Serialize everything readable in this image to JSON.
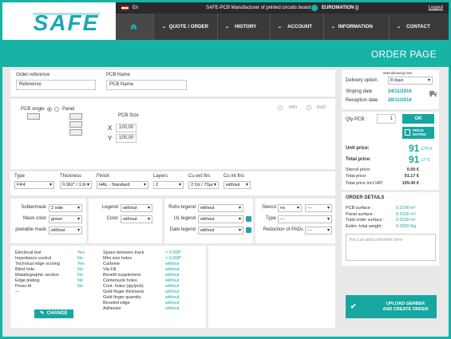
{
  "brand": {
    "logo_text": "SAFE"
  },
  "topbar": {
    "lang": "En",
    "title": "SAFE-PCB Manufacturer of printed circuits board",
    "user": "EUROMATION ()",
    "logout": "Logout"
  },
  "nav": {
    "items": [
      "QUOTE / ORDER",
      "HISTORY",
      "ACCOUNT",
      "INFORMATION",
      "CONTACT"
    ]
  },
  "page": {
    "title": "ORDER PAGE"
  },
  "reference": {
    "order_label": "Order reference",
    "order_placeholder": "Reference",
    "pcb_label": "PCB Name",
    "pcb_placeholder": "PCB Name"
  },
  "pcb": {
    "single_label": "PCB single",
    "panel_label": "Panel",
    "size_label": "PCB Size",
    "x_label": "X",
    "y_label": "Y",
    "x_value": "100,00",
    "y_value": "100,00",
    "unit_mm": "mm",
    "unit_inch": "inch"
  },
  "specs": {
    "type_label": "Type",
    "type_value": "FR4",
    "thickness_label": "Thickness",
    "thickness_value": "0.062\" / 1.6r",
    "finish_label": "Finish",
    "finish_value": "HAL - Standard",
    "layers_label": "Layers",
    "layers_value": "2",
    "cu_ext_label": "Cu ext fini.",
    "cu_ext_value": "2 Oz / 70µr",
    "cu_int_label": "Cu int fini.",
    "cu_int_value": "without"
  },
  "masks": {
    "soldermask_label": "Soldermask",
    "soldermask_value": "2 side",
    "maskcolor_label": "Mask color",
    "maskcolor_value": "green",
    "peelable_label": "peelable mask",
    "peelable_value": "without"
  },
  "legend": {
    "legend_label": "Legend",
    "legend_value": "without",
    "color_label": "Color",
    "color_value": "without"
  },
  "legends2": {
    "rohs_label": "Rohs legend",
    "rohs_value": "without",
    "ul_label": "UL legend",
    "ul_value": "without",
    "date_label": "Date legend",
    "date_value": "without"
  },
  "stencil": {
    "stencil_label": "Stencil",
    "stencil_value": "no",
    "stencil_value2": "---",
    "type_label": "Type",
    "type_value": "---",
    "reduction_label": "Reduction of PADs",
    "reduction_value": "---"
  },
  "options": {
    "left": [
      {
        "label": "Electrical test",
        "value": "Yes"
      },
      {
        "label": "Impedance control",
        "value": "No"
      },
      {
        "label": "Technical edge scoring",
        "value": "Yes"
      },
      {
        "label": "Blind hole",
        "value": "No"
      },
      {
        "label": "Matallographic section",
        "value": "No"
      },
      {
        "label": "Edge plating",
        "value": "No"
      },
      {
        "label": "Press-fit",
        "value": "No"
      },
      {
        "label": "---",
        "value": ""
      }
    ],
    "right": [
      {
        "label": "Space between track",
        "value": "> 0.008\""
      },
      {
        "label": "Mini size holes",
        "value": "> 0.008\""
      },
      {
        "label": "Carbone",
        "value": "without"
      },
      {
        "label": "Via Fill",
        "value": "without"
      },
      {
        "label": "Benefit supplement",
        "value": "without"
      },
      {
        "label": "Contersunk holes",
        "value": "without"
      },
      {
        "label": "Cont. holes (qty/pcb)",
        "value": "without"
      },
      {
        "label": "Gold finger thickness",
        "value": "without"
      },
      {
        "label": "Gold finger quantity",
        "value": "without"
      },
      {
        "label": "Beveled edge",
        "value": "without"
      },
      {
        "label": "Adhesive",
        "value": "without"
      }
    ],
    "change_button": "CHANGE"
  },
  "delivery": {
    "option_label": "Delivery option",
    "mfg_time_label": "Manufacturing time",
    "option_value": "8 days",
    "shipping_label": "Shiping date",
    "shipping_value": "24/11/2016",
    "reception_label": "Reception date",
    "reception_value": "28/11/2016"
  },
  "quantity": {
    "label": "Qty PCB :",
    "value": "1",
    "ok": "OK",
    "price_matrix": "PRICE MATRIX"
  },
  "prices": {
    "unit_label": "Unit price:",
    "unit_value": "91",
    "unit_cents": ".170 €",
    "total_label": "Total price:",
    "total_value": "91",
    "total_cents": ".17 €",
    "stencil_label": "Stencil price:",
    "stencil_value": "0.00 €",
    "total2_label": "Total price:",
    "total2_value": "91.17 €",
    "vat_label": "Total price incl.VAT:",
    "vat_value": "109.40 €"
  },
  "details": {
    "title": "ORDER DETAILS",
    "rows": [
      {
        "label": "PCB surface :",
        "value": "0.0100 m²"
      },
      {
        "label": "Panel surface :",
        "value": "0.0100 m²"
      },
      {
        "label": "Total order surface :",
        "value": "0.0100 m²"
      },
      {
        "label": "Estim. total weight :",
        "value": "0.0320 Kg"
      }
    ],
    "comment_placeholder": "You can add comment here"
  },
  "upload": {
    "label1": "UPLOAD GERBER",
    "label2": "AND CREATE ORDER"
  },
  "colors": {
    "accent": "#16b3a6",
    "nav": "#3a3a3a",
    "topbar": "#2a2a2a"
  }
}
